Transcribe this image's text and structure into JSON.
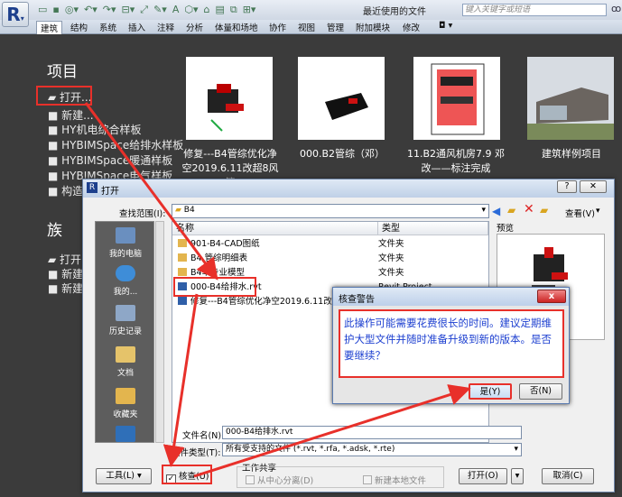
{
  "app": {
    "logo": "R",
    "qat_icons": [
      "open-icon",
      "save-icon",
      "sync-icon",
      "undo-icon",
      "redo-icon",
      "measure-icon",
      "dimension-icon",
      "text-icon",
      "3d-icon",
      "section-icon",
      "thin-lines-icon",
      "close-hidden-icon",
      "switch-windows-icon"
    ],
    "title": "最近使用的文件",
    "search_placeholder": "键入关键字或短语"
  },
  "ribbon": {
    "tabs": [
      "建筑",
      "结构",
      "系统",
      "插入",
      "注释",
      "分析",
      "体量和场地",
      "协作",
      "视图",
      "管理",
      "附加模块",
      "修改"
    ],
    "extra": "◘ ▾"
  },
  "projects": {
    "title": "项目",
    "links": [
      "打开...",
      "新建...",
      "HY机电综合样板",
      "HYBIMSpace给排水样板",
      "HYBIMSpace暖通样板",
      "HYBIMSpace电气样板",
      "构造..."
    ],
    "recent": [
      {
        "caption": "修复---B4管综优化净空2019.6.11改超8风管"
      },
      {
        "caption": "000.B2管综（邓）"
      },
      {
        "caption": "11.B2通风机房7.9 邓改——标注完成"
      },
      {
        "caption": "建筑样例项目"
      }
    ]
  },
  "families": {
    "title": "族",
    "links": [
      "打开...",
      "新建...",
      "新建..."
    ]
  },
  "open_dialog": {
    "title": "打开",
    "lookin_label": "查找范围(I):",
    "lookin_value": "B4",
    "view_label": "查看(V)",
    "preview_label": "预览",
    "sidebar": [
      "我的电脑",
      "我的...",
      "历史记录",
      "文档",
      "收藏夹",
      ""
    ],
    "columns": [
      "名称",
      "类型"
    ],
    "files": [
      {
        "name": "901-B4-CAD图纸",
        "type": "文件夹",
        "kind": "folder"
      },
      {
        "name": "B4 管综明细表",
        "type": "文件夹",
        "kind": "folder"
      },
      {
        "name": "B4单专业模型",
        "type": "文件夹",
        "kind": "folder"
      },
      {
        "name": "000-B4给排水.rvt",
        "type": "Revit Project",
        "kind": "rvt"
      },
      {
        "name": "修复---B4管综优化净空2019.6.11改超8风管.rvt",
        "type": "",
        "kind": "rvt"
      }
    ],
    "filename_label": "文件名(N):",
    "filename_value": "000-B4给排水.rvt",
    "filetype_label": "文件类型(T):",
    "filetype_value": "所有受支持的文件 (*.rvt, *.rfa, *.adsk, *.rte)",
    "tools_label": "工具(L)",
    "audit_label": "核查(U)",
    "audit_checked": true,
    "worksharing_label": "工作共享",
    "detach_label": "从中心分离(D)",
    "newlocal_label": "新建本地文件",
    "open_label": "打开(O)",
    "cancel_label": "取消(C)"
  },
  "audit_warning": {
    "title": "核查警告",
    "message": "此操作可能需要花费很长的时间。建议定期维护大型文件并随时准备升级到新的版本。是否要继续？",
    "yes_label": "是(Y)",
    "no_label": "否(N)",
    "close_label": "x"
  },
  "colors": {
    "highlight": "#e8302a",
    "message_text": "#1c3fd0"
  }
}
